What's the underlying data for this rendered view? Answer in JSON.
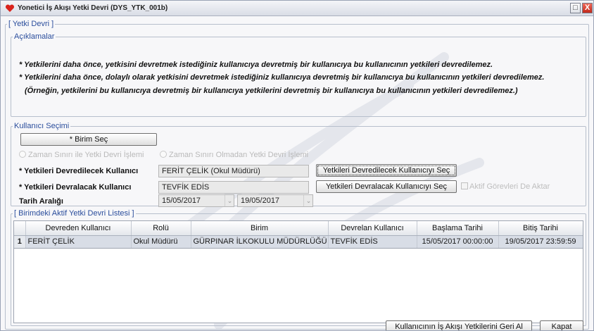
{
  "window": {
    "title": "Yonetici İş Akışı Yetki Devri (DYS_YTK_001b)",
    "max_icon": "maximize-icon",
    "close_icon": "close-icon",
    "max_glyph": "□",
    "close_glyph": "X"
  },
  "groups": {
    "outer": "[ Yetki Devri ]",
    "explanations": "Açıklamalar",
    "user_selection": "Kullanıcı Seçimi",
    "list": "[ Birimdeki Aktif Yetki Devri Listesi ]"
  },
  "explanations": [
    "* Yetkilerini daha önce, yetkisini devretmek istediğiniz kullanıcıya devretmiş bir kullanıcıya bu kullanıcının yetkileri devredilemez.",
    "* Yetkilerini daha önce, dolaylı olarak yetkisini devretmek istediğiniz kullanıcıya devretmiş bir kullanıcıya bu kullanıcının yetkileri devredilemez.",
    "(Örneğin, yetkilerini bu kullanıcıya devretmiş bir kullanıcıya yetkilerini devretmiş bir kullanıcıya bu kullanıcının yetkileri devredilemez.)"
  ],
  "selection": {
    "unit_button": "* Birim Seç",
    "radio_with_limit": "Zaman Sınırı ile Yetki Devri İşlemi",
    "radio_without_limit": "Zaman Sınırı Olmadan Yetki Devri İşlemi",
    "from_user_label": "* Yetkileri Devredilecek Kullanıcı",
    "from_user_value": "FERİT ÇELİK (Okul Müdürü)",
    "from_user_button": "Yetkileri Devredilecek Kullanıcıyı Seç",
    "to_user_label": "* Yetkileri Devralacak Kullanıcı",
    "to_user_value": "TEVFİK EDİS",
    "to_user_button": "Yetkileri Devralacak Kullanıcıyı Seç",
    "active_duties_checkbox": "Aktif Görevleri De Aktar",
    "date_range_label": "Tarih Aralığı",
    "start_date": "15/05/2017",
    "end_date": "19/05/2017",
    "dropdown_glyph": "⌄"
  },
  "table": {
    "columns": [
      "",
      "Devreden Kullanıcı",
      "Rolü",
      "Birim",
      "Devrelan Kullanıcı",
      "Başlama Tarihi",
      "Bitiş Tarihi"
    ],
    "rows": [
      [
        "1",
        "FERİT ÇELİK",
        "Okul Müdürü",
        "GÜRPINAR İLKOKULU MÜDÜRLÜĞÜ",
        "TEVFİK EDİS",
        "15/05/2017 00:00:00",
        "19/05/2017 23:59:59"
      ]
    ]
  },
  "footer": {
    "revoke_button": "Kullanıcının İş Akışı Yetkilerini Geri Al",
    "close_button": "Kapat"
  },
  "colors": {
    "legend_text": "#2a4d9c",
    "selected_row": "#d8dde6",
    "close_button": "#c0281b"
  }
}
